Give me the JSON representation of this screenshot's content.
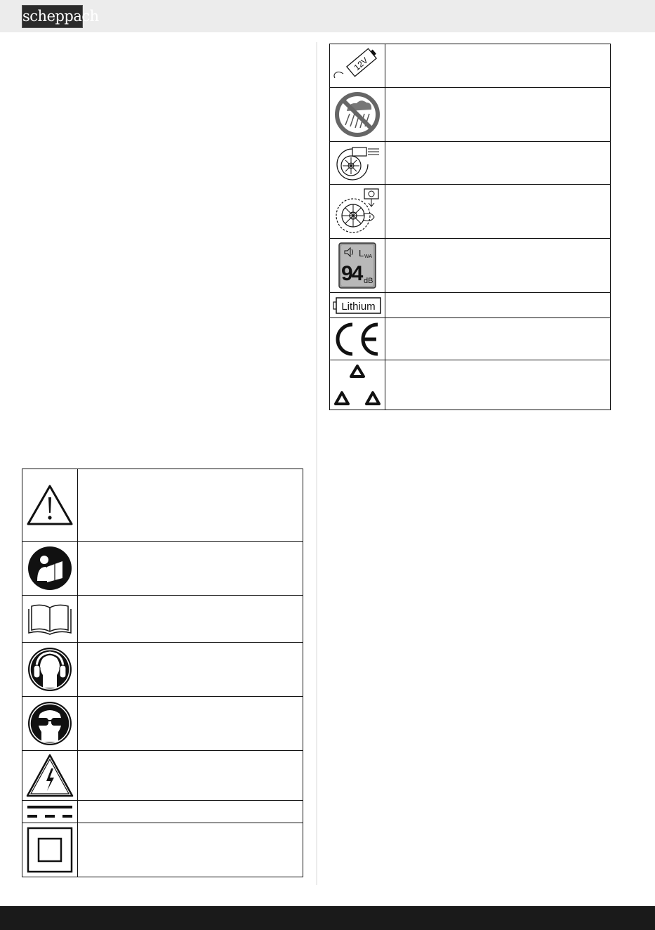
{
  "header": {
    "brand": "scheppach"
  },
  "right_table": {
    "rows": [
      {
        "icon": "battery-12v-icon",
        "icon_text": "12V",
        "text": ""
      },
      {
        "icon": "no-rain-icon",
        "text": ""
      },
      {
        "icon": "blower-fan-icon",
        "text": ""
      },
      {
        "icon": "fan-assembly-icon",
        "text": ""
      },
      {
        "icon": "sound-power-label-icon",
        "label_l": "L",
        "label_wa": "WA",
        "label_value": "94",
        "label_unit": "dB",
        "text": ""
      },
      {
        "icon": "lithium-battery-icon",
        "icon_text": "Lithium",
        "text": ""
      },
      {
        "icon": "ce-mark-icon",
        "text": ""
      },
      {
        "icon": "recycling-triangle-icon",
        "text": ""
      }
    ]
  },
  "left_table": {
    "rows": [
      {
        "icon": "warning-triangle-icon",
        "text": ""
      },
      {
        "icon": "read-manual-person-icon",
        "text": ""
      },
      {
        "icon": "open-book-icon",
        "text": ""
      },
      {
        "icon": "ear-protection-icon",
        "text": ""
      },
      {
        "icon": "eye-protection-icon",
        "text": ""
      },
      {
        "icon": "electric-hazard-icon",
        "text": ""
      },
      {
        "icon": "dc-current-icon",
        "text": ""
      },
      {
        "icon": "protection-class-ii-icon",
        "text": ""
      }
    ]
  }
}
